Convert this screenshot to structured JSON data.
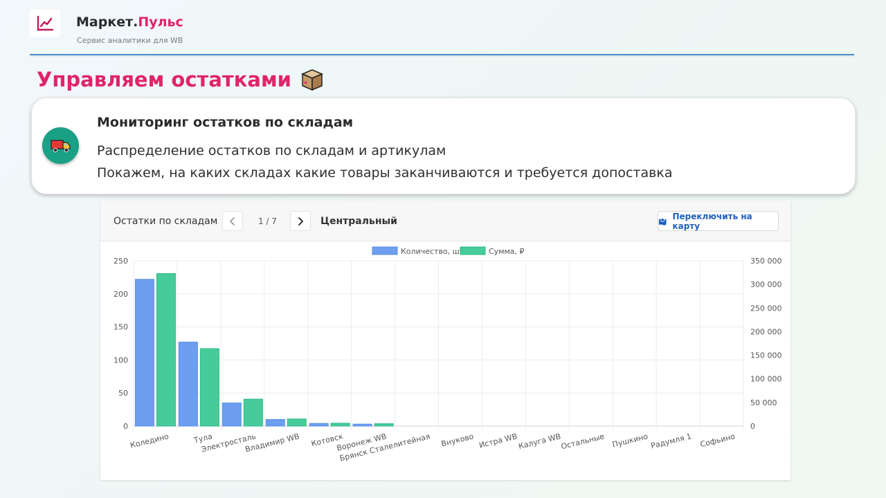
{
  "header": {
    "brand_main": "Маркет.",
    "brand_accent": "Пульс",
    "subtitle": "Сервис аналитики для WB"
  },
  "page": {
    "title": "Управляем остатками"
  },
  "card": {
    "title": "Мониторинг остатков по складам",
    "line1": "Распределение остатков по складам и артикулам",
    "line2": "Покажем, на каких складах какие товары заканчиваются и требуется допоставка"
  },
  "panel": {
    "title": "Остатки по складам",
    "pager": "1 / 7",
    "region": "Центральный",
    "map_button": "Переключить на карту"
  },
  "colors": {
    "accent": "#e0246a",
    "qty": "#6d9ef0",
    "sum": "#45cc9a",
    "card_icon_bg": "#1aa085"
  },
  "chart_data": {
    "type": "bar",
    "categories": [
      "Коледино",
      "Тула",
      "Электросталь",
      "Владимир WB",
      "Котовск",
      "Воронеж WB",
      "Брянск Сталелитейная",
      "Внуково",
      "Истра WB",
      "Калуга WB",
      "Остальные",
      "Пушкино",
      "Радумля 1",
      "Софьино"
    ],
    "series": [
      {
        "name": "Количество, шт",
        "axis": "left",
        "values": [
          222,
          127,
          35,
          10,
          4,
          3,
          0,
          0,
          0,
          0,
          0,
          0,
          0,
          0
        ]
      },
      {
        "name": "Сумма, ₽",
        "axis": "right",
        "values": [
          323000,
          164000,
          57000,
          15000,
          6000,
          5000,
          0,
          0,
          0,
          0,
          0,
          0,
          0,
          0
        ]
      }
    ],
    "y_left": {
      "ylim": [
        0,
        250
      ],
      "ticks": [
        "0",
        "50",
        "100",
        "150",
        "200",
        "250"
      ]
    },
    "y_right": {
      "ylim": [
        0,
        350000
      ],
      "ticks": [
        "0",
        "50 000",
        "100 000",
        "150 000",
        "200 000",
        "250 000",
        "300 000",
        "350 000"
      ]
    },
    "grid": true,
    "legend": "top-center"
  }
}
